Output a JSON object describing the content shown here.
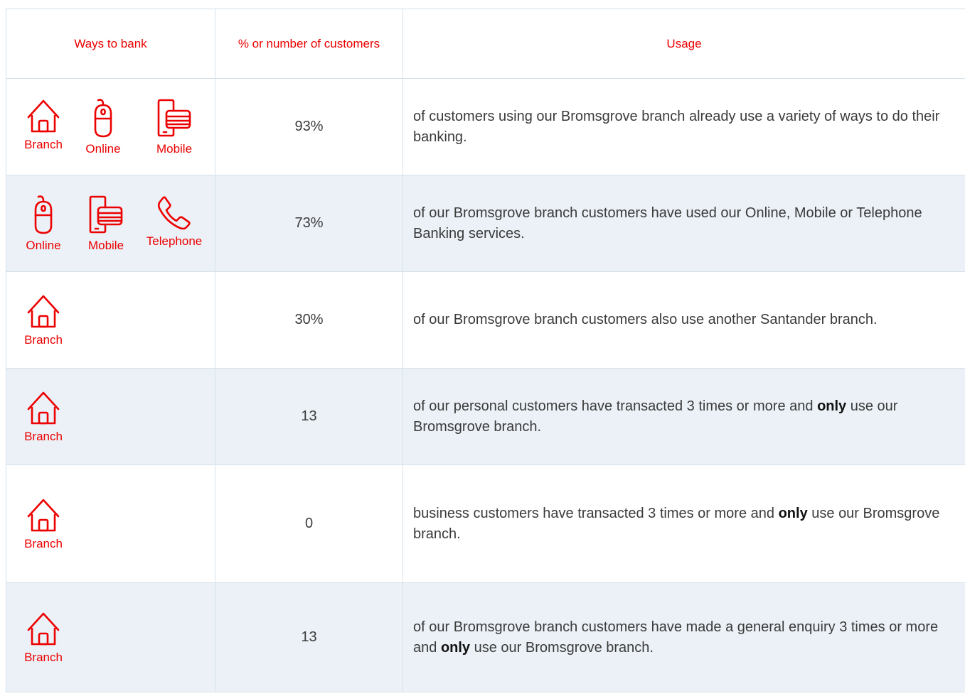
{
  "header": {
    "ways": "Ways to bank",
    "count": "% or number of customers",
    "usage": "Usage"
  },
  "colors": {
    "accent": "#ec0000",
    "row_alt": "#ebf1f7",
    "border": "#d6e2ea"
  },
  "labels": {
    "branch": "Branch",
    "online": "Online",
    "mobile": "Mobile",
    "telephone": "Telephone"
  },
  "rows": [
    {
      "icons": [
        "house-icon",
        "mouse-icon",
        "phone-card-icon"
      ],
      "value": "93%",
      "usage": {
        "before": "of customers using our Bromsgrove branch already use a variety of ways to do their banking.",
        "bold": "",
        "after": ""
      }
    },
    {
      "icons": [
        "mouse-icon",
        "phone-card-icon",
        "telephone-icon"
      ],
      "value": "73%",
      "usage": {
        "before": "of our Bromsgrove branch customers have used our Online, Mobile or Telephone Banking services.",
        "bold": "",
        "after": ""
      }
    },
    {
      "icons": [
        "house-icon"
      ],
      "value": "30%",
      "usage": {
        "before": "of our Bromsgrove branch customers also use another Santander branch.",
        "bold": "",
        "after": ""
      }
    },
    {
      "icons": [
        "house-icon"
      ],
      "value": "13",
      "usage": {
        "before": "of our personal customers have transacted 3 times or more and ",
        "bold": "only",
        "after": " use our Bromsgrove branch."
      }
    },
    {
      "icons": [
        "house-icon"
      ],
      "value": "0",
      "usage": {
        "before": "business customers have transacted 3 times or more and ",
        "bold": "only",
        "after": " use our Bromsgrove branch."
      }
    },
    {
      "icons": [
        "house-icon"
      ],
      "value": "13",
      "usage": {
        "before": "of our Bromsgrove branch customers have made a general enquiry 3 times or more and ",
        "bold": "only",
        "after": " use our Bromsgrove branch."
      }
    }
  ]
}
